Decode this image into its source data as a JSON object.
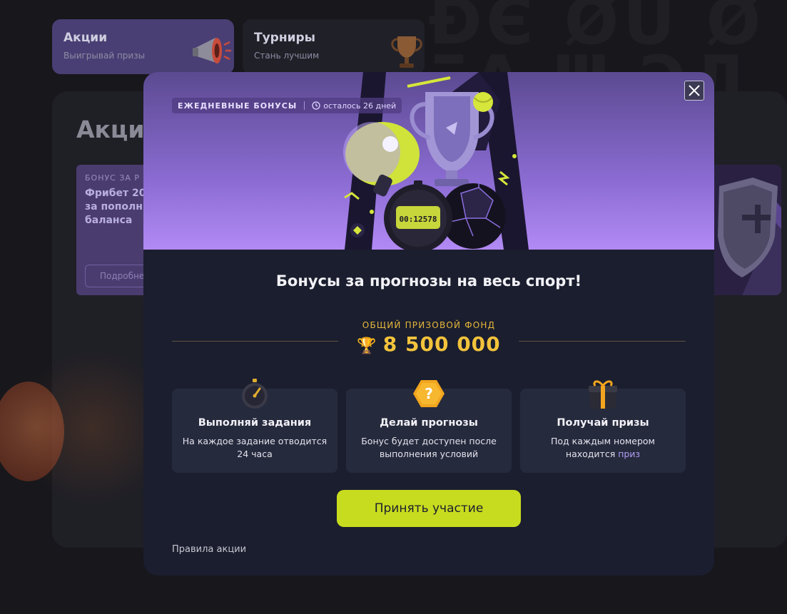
{
  "tiles": [
    {
      "title": "Акции",
      "subtitle": "Выигрывай призы"
    },
    {
      "title": "Турниры",
      "subtitle": "Стань лучшим"
    }
  ],
  "panel": {
    "title": "Акци",
    "promo": {
      "kicker": "БОНУС ЗА Р",
      "title": "Фрибет 20 за пополн баланса",
      "button": "Подробне"
    }
  },
  "modal": {
    "chip_label": "ЕЖЕДНЕВНЫЕ БОНУСЫ",
    "chip_timer": "осталось 26 дней",
    "timer_display": "00:12578",
    "headline": "Бонусы за прогнозы на весь спорт!",
    "fund_label": "ОБЩИЙ ПРИЗОВОЙ ФОНД",
    "fund_value": "8 500 000",
    "steps": [
      {
        "icon": "stopwatch-icon",
        "title": "Выполняй задания",
        "desc": "На каждое задание отводится 24 часа"
      },
      {
        "icon": "question-hexagon-icon",
        "title": "Делай прогнозы",
        "desc": "Бонус будет доступен после выполнения условий"
      },
      {
        "icon": "gift-icon",
        "title": "Получай призы",
        "desc_prefix": "Под каждым номером находится",
        "desc_link": "приз"
      }
    ],
    "cta": "Принять участие",
    "rules": "Правила акции"
  },
  "colors": {
    "accent": "#c8dc1f",
    "gold": "#f3c33c",
    "modal_bg": "#1b1e2e",
    "card_bg": "#262a3d",
    "hero_purple": "#8a6bd1"
  }
}
